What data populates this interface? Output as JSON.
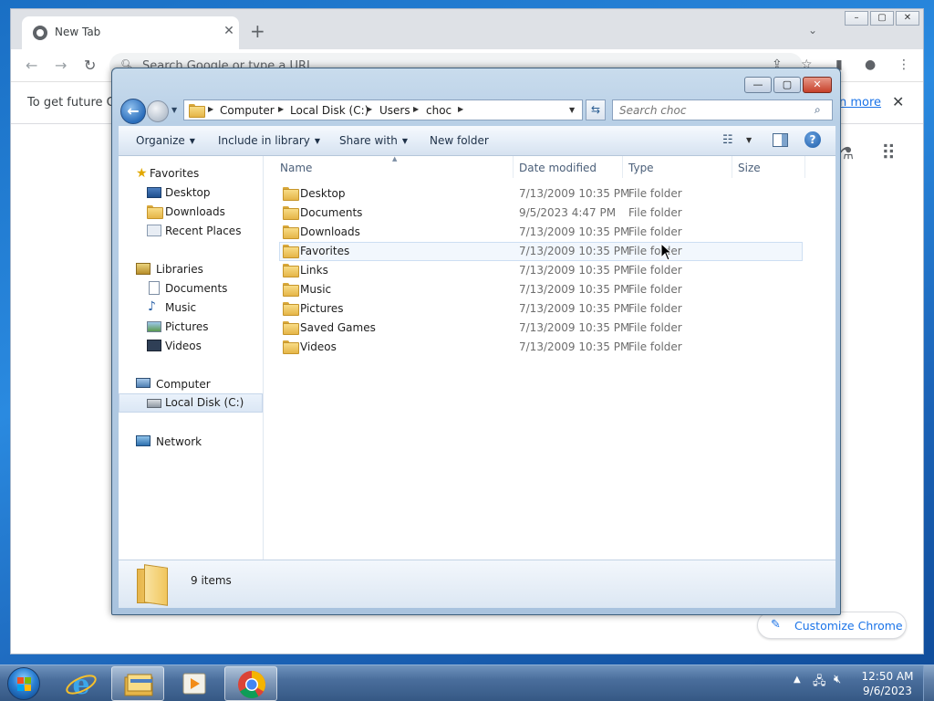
{
  "chrome": {
    "tab_title": "New Tab",
    "tab_close": "✕",
    "new_tab": "+",
    "omnibox_placeholder": "Search Google or type a URL",
    "infobar_text": "To get future Go",
    "infobar_link": "n more",
    "infobar_close": "✕",
    "customize_label": "Customize Chrome"
  },
  "explorer": {
    "window_controls": {
      "minimize": "—",
      "maximize": "▢",
      "close": "✕"
    },
    "breadcrumb": [
      "Computer",
      "Local Disk (C:)",
      "Users",
      "choc"
    ],
    "search_placeholder": "Search choc",
    "commands": {
      "organize": "Organize",
      "include_in_library": "Include in library",
      "share_with": "Share with",
      "new_folder": "New folder"
    },
    "nav": {
      "favorites": "Favorites",
      "desktop": "Desktop",
      "downloads": "Downloads",
      "recent_places": "Recent Places",
      "libraries": "Libraries",
      "documents": "Documents",
      "music": "Music",
      "pictures": "Pictures",
      "videos": "Videos",
      "computer": "Computer",
      "local_disk": "Local Disk (C:)",
      "network": "Network"
    },
    "columns": {
      "name": "Name",
      "date_modified": "Date modified",
      "type": "Type",
      "size": "Size"
    },
    "files": [
      {
        "name": "Desktop",
        "date": "7/13/2009 10:35 PM",
        "type": "File folder"
      },
      {
        "name": "Documents",
        "date": "9/5/2023 4:47 PM",
        "type": "File folder"
      },
      {
        "name": "Downloads",
        "date": "7/13/2009 10:35 PM",
        "type": "File folder"
      },
      {
        "name": "Favorites",
        "date": "7/13/2009 10:35 PM",
        "type": "File folder"
      },
      {
        "name": "Links",
        "date": "7/13/2009 10:35 PM",
        "type": "File folder"
      },
      {
        "name": "Music",
        "date": "7/13/2009 10:35 PM",
        "type": "File folder"
      },
      {
        "name": "Pictures",
        "date": "7/13/2009 10:35 PM",
        "type": "File folder"
      },
      {
        "name": "Saved Games",
        "date": "7/13/2009 10:35 PM",
        "type": "File folder"
      },
      {
        "name": "Videos",
        "date": "7/13/2009 10:35 PM",
        "type": "File folder"
      }
    ],
    "status": "9 items"
  },
  "taskbar": {
    "time": "12:50 AM",
    "date": "9/6/2023"
  },
  "colors": {
    "accent": "#1a73e8",
    "close_red": "#c6402a",
    "folder_yellow": "#e5b548"
  }
}
